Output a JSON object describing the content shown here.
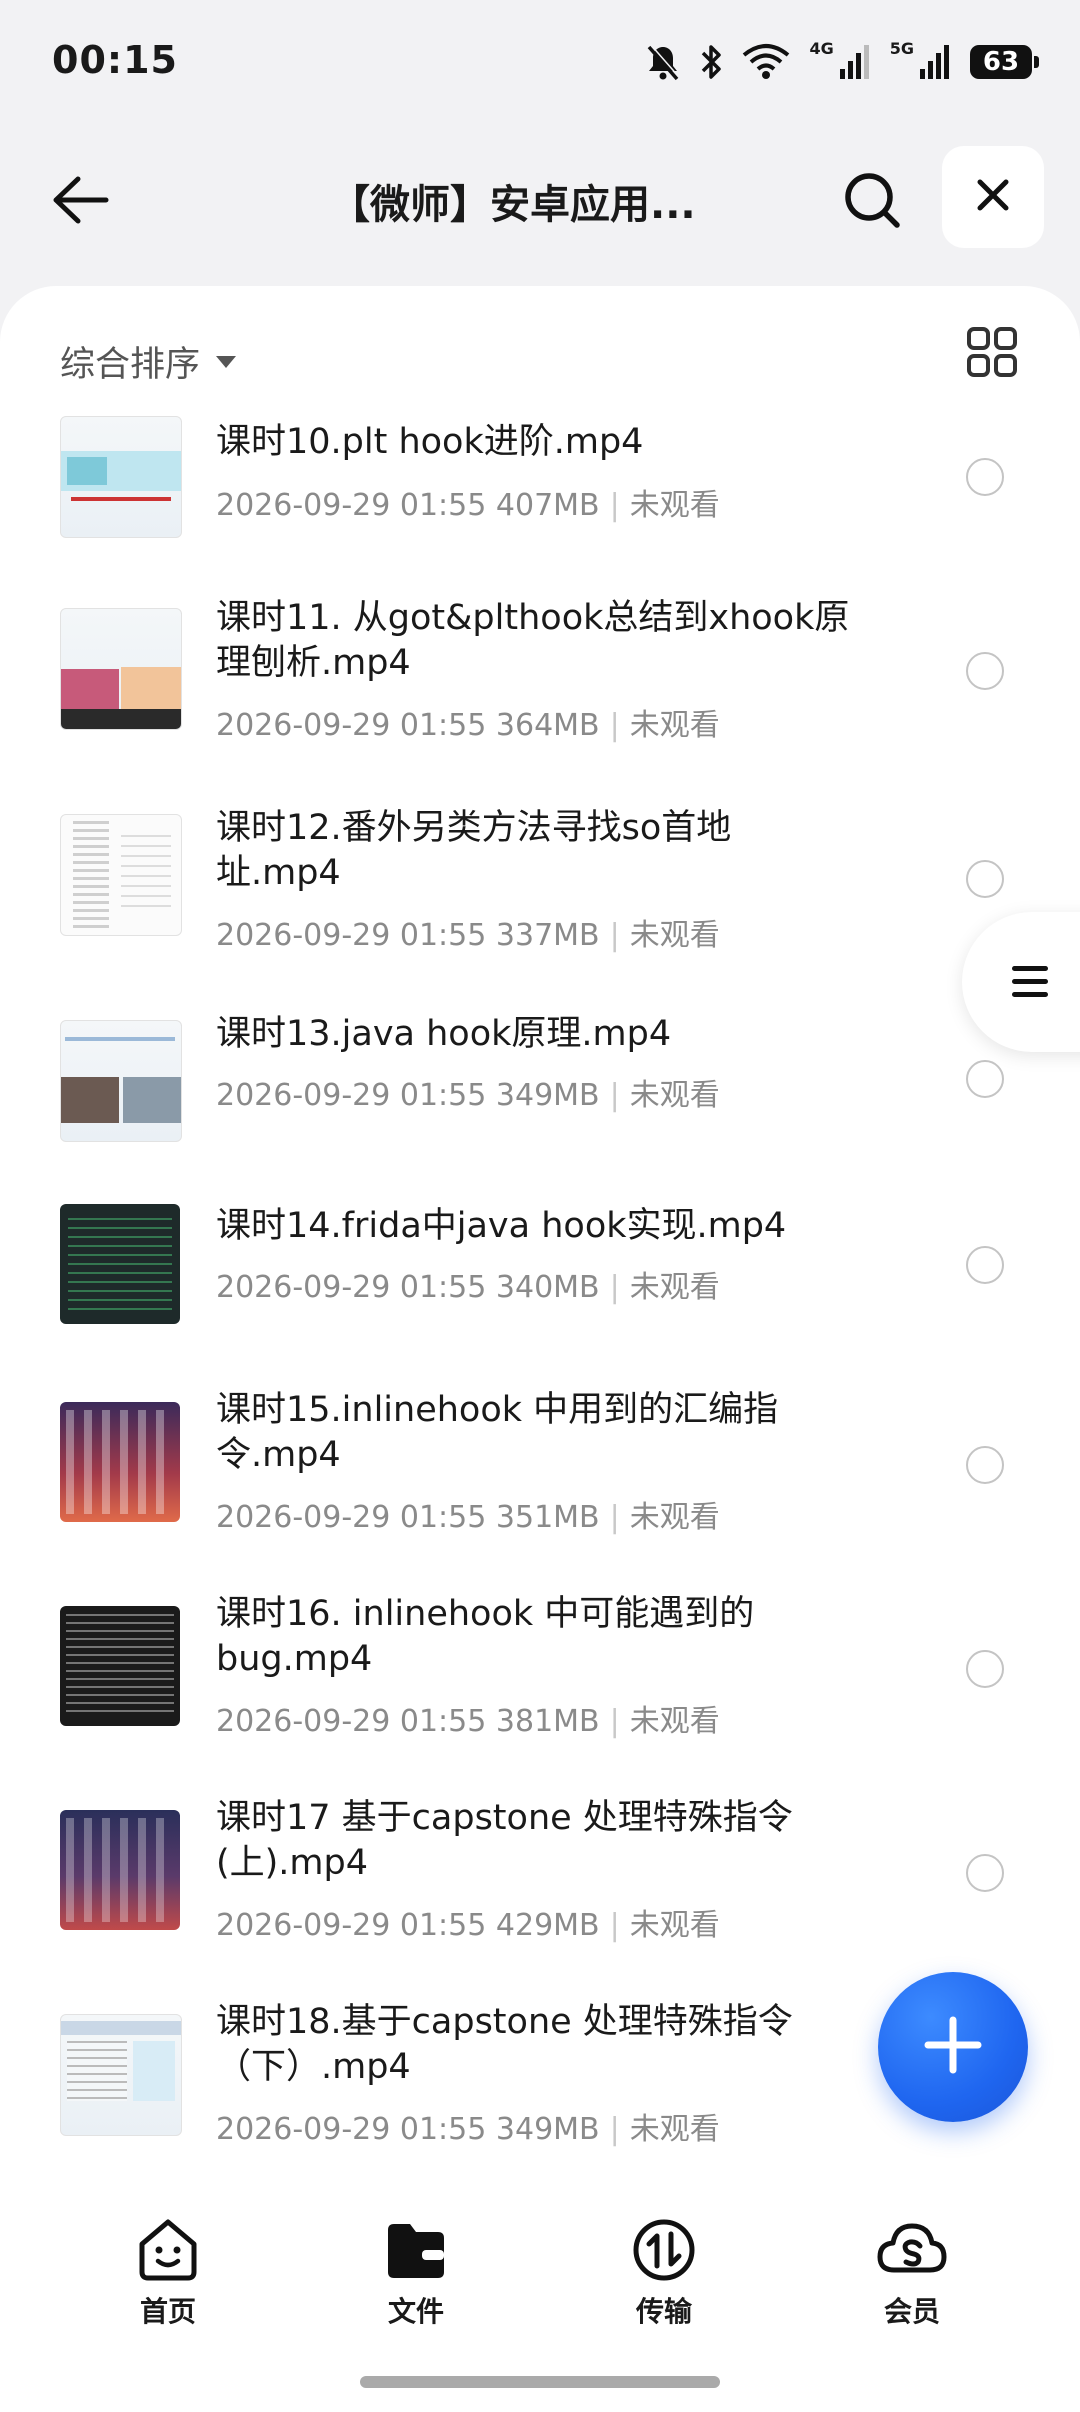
{
  "status_bar": {
    "time": "00:15",
    "battery": "63",
    "net_4g": "4G",
    "net_5g": "5G"
  },
  "header": {
    "title": "【微师】安卓应用..."
  },
  "sort": {
    "label": "综合排序"
  },
  "files": [
    {
      "name": "课时10.plt hook进阶.mp4",
      "date": "2026-09-29 01:55",
      "size": "407MB",
      "status": "未观看"
    },
    {
      "name": "课时11. 从got&plthook总结到xhook原理刨析.mp4",
      "date": "2026-09-29 01:55",
      "size": "364MB",
      "status": "未观看"
    },
    {
      "name": "课时12.番外另类方法寻找so首地址.mp4",
      "date": "2026-09-29 01:55",
      "size": "337MB",
      "status": "未观看"
    },
    {
      "name": "课时13.java hook原理.mp4",
      "date": "2026-09-29 01:55",
      "size": "349MB",
      "status": "未观看"
    },
    {
      "name": "课时14.frida中java hook实现.mp4",
      "date": "2026-09-29 01:55",
      "size": "340MB",
      "status": "未观看"
    },
    {
      "name": "课时15.inlinehook 中用到的汇编指令.mp4",
      "date": "2026-09-29 01:55",
      "size": "351MB",
      "status": "未观看"
    },
    {
      "name": "课时16. inlinehook 中可能遇到的bug.mp4",
      "date": "2026-09-29 01:55",
      "size": "381MB",
      "status": "未观看"
    },
    {
      "name": "课时17 基于capstone 处理特殊指令(上).mp4",
      "date": "2026-09-29 01:55",
      "size": "429MB",
      "status": "未观看"
    },
    {
      "name": "课时18.基于capstone 处理特殊指令（下）.mp4",
      "date": "2026-09-29 01:55",
      "size": "349MB",
      "status": "未观看"
    }
  ],
  "bottom_nav": [
    {
      "label": "首页",
      "icon": "home-face-icon"
    },
    {
      "label": "文件",
      "icon": "folder-icon"
    },
    {
      "label": "传输",
      "icon": "transfer-icon"
    },
    {
      "label": "会员",
      "icon": "cloud-vip-icon"
    }
  ],
  "colors": {
    "accent": "#1f66f0",
    "background": "#f2f2f4",
    "meta_text": "#8a8a8a"
  }
}
